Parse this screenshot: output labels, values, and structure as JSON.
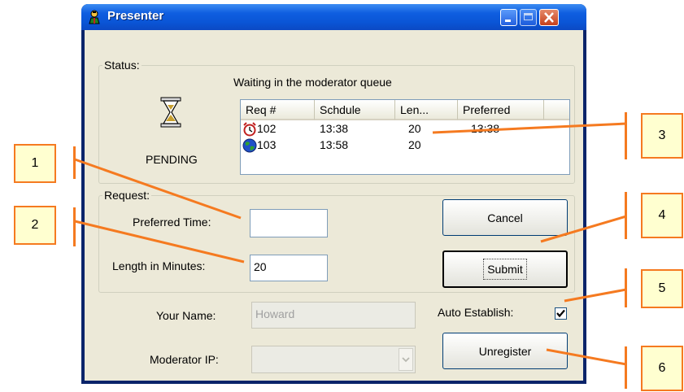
{
  "window": {
    "title": "Presenter"
  },
  "status": {
    "legend": "Status:",
    "message": "Waiting in the moderator queue",
    "state": "PENDING",
    "queue": {
      "columns": [
        "Req #",
        "Schdule",
        "Len...",
        "Preferred"
      ],
      "rows": [
        {
          "icon": "alarm-clock-icon",
          "req": "102",
          "schedule": "13:38",
          "length": "20",
          "preferred": "13:38"
        },
        {
          "icon": "globe-icon",
          "req": "103",
          "schedule": "13:58",
          "length": "20",
          "preferred": ""
        }
      ]
    }
  },
  "request": {
    "legend": "Request:",
    "preferred_time_label": "Preferred Time:",
    "preferred_time_value": "",
    "length_label": "Length in Minutes:",
    "length_value": "20",
    "cancel_label": "Cancel",
    "submit_label": "Submit"
  },
  "footer": {
    "your_name_label": "Your Name:",
    "your_name_value": "Howard",
    "moderator_ip_label": "Moderator IP:",
    "moderator_ip_value": "",
    "auto_establish_label": "Auto Establish:",
    "auto_establish_checked": true,
    "unregister_label": "Unregister"
  },
  "callouts": [
    "1",
    "2",
    "3",
    "4",
    "5",
    "6"
  ],
  "colors": {
    "callout_fill": "#ffffd0",
    "callout_border": "#f57a20",
    "titlebar": "#0a55d6",
    "window_face": "#ece9d8"
  }
}
